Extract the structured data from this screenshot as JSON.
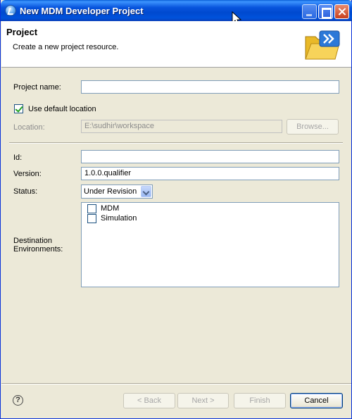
{
  "window": {
    "title": "New MDM Developer Project"
  },
  "banner": {
    "title": "Project",
    "description": "Create a new project resource."
  },
  "project": {
    "name_label": "Project name:",
    "name_value": "",
    "use_default_label": "Use default location",
    "use_default_checked": true,
    "location_label": "Location:",
    "location_value": "E:\\sudhir\\workspace",
    "browse_label": "Browse..."
  },
  "metadata": {
    "id_label": "Id:",
    "id_value": "",
    "version_label": "Version:",
    "version_value": "1.0.0.qualifier",
    "status_label": "Status:",
    "status_value": "Under Revision",
    "destination_label_line1": "Destination",
    "destination_label_line2": "Environments:",
    "environments": [
      {
        "label": "MDM",
        "checked": false
      },
      {
        "label": "Simulation",
        "checked": false
      }
    ]
  },
  "footer": {
    "help_glyph": "?",
    "back_label": "< Back",
    "next_label": "Next >",
    "finish_label": "Finish",
    "cancel_label": "Cancel"
  }
}
